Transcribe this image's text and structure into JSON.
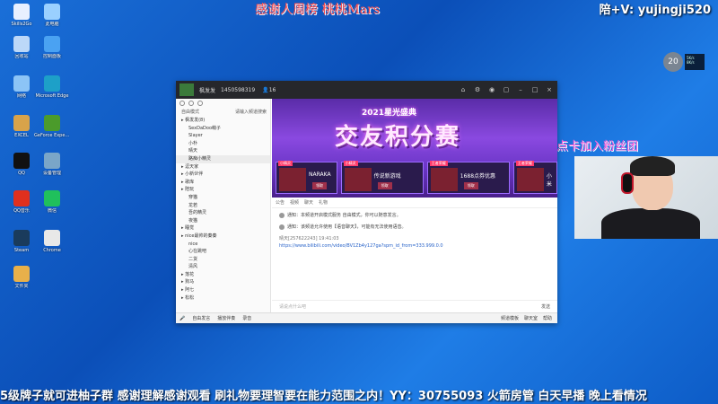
{
  "desktop_icons": [
    {
      "label": "Skills2Go",
      "color": "#e8f0ff"
    },
    {
      "label": "此电脑",
      "color": "#9ad0ff"
    },
    {
      "label": "回收站",
      "color": "#bcd8f8"
    },
    {
      "label": "控制面板",
      "color": "#4aa2f2"
    },
    {
      "label": "网络",
      "color": "#8cc4f6"
    },
    {
      "label": "Microsoft Edge",
      "color": "#1da0c8"
    },
    {
      "label": "EXCEL",
      "color": "#d8a34a"
    },
    {
      "label": "GeForce Experience",
      "color": "#4b9b2b"
    },
    {
      "label": "QQ",
      "color": "#111111"
    },
    {
      "label": "设备管理",
      "color": "#7aa6c8"
    },
    {
      "label": "QQ音乐",
      "color": "#e0301e"
    },
    {
      "label": "微信",
      "color": "#20c05c"
    },
    {
      "label": "Steam",
      "color": "#1a3b5c"
    },
    {
      "label": "Chrome",
      "color": "#e8e8e8"
    },
    {
      "label": "文件夹",
      "color": "#e8b04a"
    }
  ],
  "overlay": {
    "top_text": "感谢人周榜 桃桃Mars",
    "right_text": "陪+V: yujingji520",
    "fans_text": "点卡加入粉丝团",
    "marquee": "5级牌子就可进柚子群  感谢理解感谢观看 刷礼物要理智要在能力范围之内！YY：30755093  火箭房管 白天早播 晚上看情况"
  },
  "tray": {
    "bubble": "20",
    "net_up": "5K/s",
    "net_down": "8K/s"
  },
  "window": {
    "username": "枫发发",
    "user_id": "1450598319",
    "viewers": "16",
    "toolbar_icons": [
      "home-icon",
      "settings-icon",
      "gamepad-icon",
      "folder-icon",
      "minimize-icon",
      "maximize-icon",
      "close-icon"
    ],
    "left": {
      "mode_label": "自由模式",
      "mode_right": "请输入频道搜索",
      "channels": [
        {
          "label": "枫发发(8)",
          "sub": false,
          "sel": false
        },
        {
          "label": "SexDaDoo萌子",
          "sub": true,
          "sel": false
        },
        {
          "label": "Slayer",
          "sub": true,
          "sel": false
        },
        {
          "label": "小朴",
          "sub": true,
          "sel": false
        },
        {
          "label": "晴天",
          "sub": true,
          "sel": false
        },
        {
          "label": "路痴小精灵",
          "sub": true,
          "sel": true
        },
        {
          "label": "逗天家",
          "sub": false,
          "sel": false
        },
        {
          "label": "小新伙伴",
          "sub": false,
          "sel": false
        },
        {
          "label": "歌库",
          "sub": false,
          "sel": false
        },
        {
          "label": "陪玩",
          "sub": false,
          "sel": false
        },
        {
          "label": "穿猫",
          "sub": true,
          "sel": false
        },
        {
          "label": "龙若",
          "sub": true,
          "sel": false
        },
        {
          "label": "吾的精灵",
          "sub": true,
          "sel": false
        },
        {
          "label": "夜猫",
          "sub": true,
          "sel": false
        },
        {
          "label": "睡觉",
          "sub": false,
          "sel": false
        },
        {
          "label": "nice最帅的秦秦",
          "sub": false,
          "sel": false
        },
        {
          "label": "nice",
          "sub": true,
          "sel": false
        },
        {
          "label": "心在跳吧",
          "sub": true,
          "sel": false
        },
        {
          "label": "二货",
          "sub": true,
          "sel": false
        },
        {
          "label": "清风",
          "sub": true,
          "sel": false
        },
        {
          "label": "落花",
          "sub": false,
          "sel": false
        },
        {
          "label": "狗马",
          "sub": false,
          "sel": false
        },
        {
          "label": "阿七",
          "sub": false,
          "sel": false
        },
        {
          "label": "松松",
          "sub": false,
          "sel": false
        }
      ]
    },
    "banner": {
      "subtitle": "2021星光盛典",
      "title": "交友积分赛",
      "cards": [
        {
          "tag": "小精灵",
          "name": "NARAKA",
          "btn": "领取"
        },
        {
          "tag": "小精灵",
          "name": "传说新游戏",
          "btn": "领取"
        },
        {
          "tag": "王者荣耀",
          "name": "1688点券优惠",
          "btn": "领取"
        },
        {
          "tag": "王者荣耀",
          "name": "小米",
          "btn": ""
        }
      ]
    },
    "tabs": [
      "公告",
      "视频",
      "聊天",
      "礼物"
    ],
    "messages": [
      {
        "text": "通知：本频道开启模式服务 自由模式，你可以随意发言。"
      },
      {
        "text": "通知：该频道允许使用【语音聊天】，可能有无法使用语音。"
      }
    ],
    "chat_user": "晴天[257622243] 19:41:03",
    "chat_link": "https://www.bilibili.com/video/BV1Zb4y127ga?spm_id_from=333.999.0.0",
    "input_placeholder": "请说点什么吧",
    "send_label": "发送",
    "bottom": {
      "left_items": [
        "自由发言",
        "播放伴奏",
        "录音"
      ],
      "right_items": [
        "频道模板",
        "聊天室",
        "帮助"
      ]
    }
  }
}
